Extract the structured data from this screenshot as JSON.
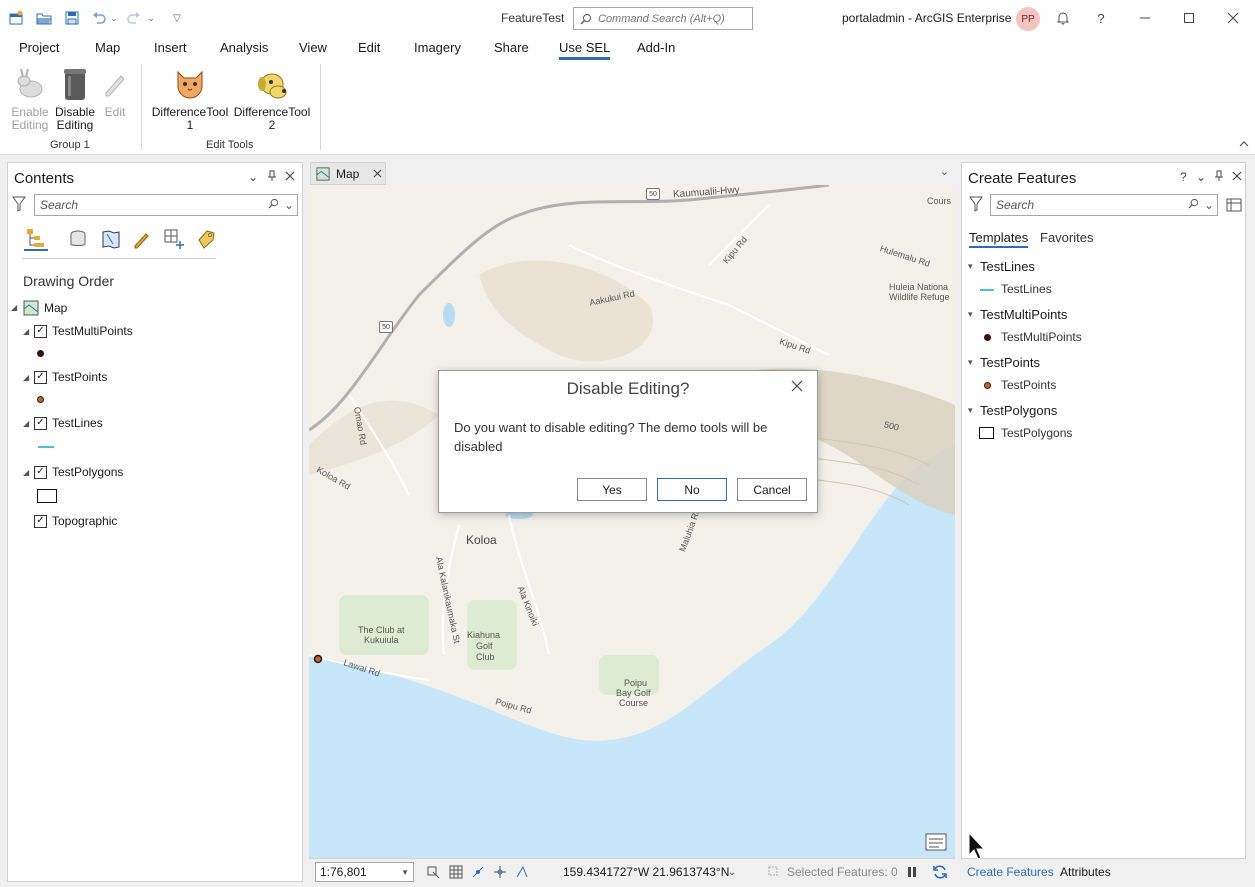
{
  "titlebar": {
    "app_title": "FeatureTest",
    "command_search_placeholder": "Command Search (Alt+Q)",
    "portal_label": "portaladmin - ArcGIS Enterprise",
    "avatar_initials": "PP",
    "help": "?"
  },
  "menu": {
    "tabs": [
      "Project",
      "Map",
      "Insert",
      "Analysis",
      "View",
      "Edit",
      "Imagery",
      "Share",
      "Use SEL",
      "Add-In"
    ],
    "active_tab": "Use SEL"
  },
  "ribbon": {
    "enable_editing": [
      "Enable",
      "Editing"
    ],
    "disable_editing": [
      "Disable",
      "Editing"
    ],
    "edit": "Edit",
    "group1_label": "Group 1",
    "difference_tool_1": [
      "DifferenceTool",
      "1"
    ],
    "difference_tool_2": [
      "DifferenceTool",
      "2"
    ],
    "edit_tools_label": "Edit Tools"
  },
  "contents": {
    "title": "Contents",
    "search_placeholder": "Search",
    "drawing_order": "Drawing Order",
    "map_label": "Map",
    "layers": {
      "multipoints": "TestMultiPoints",
      "points": "TestPoints",
      "lines": "TestLines",
      "polygons": "TestPolygons",
      "topographic": "Topographic"
    }
  },
  "map": {
    "tab_label": "Map",
    "labels": {
      "kaumualii": "Kaumualii-Hwy",
      "aakukui": "Aakukui Rd",
      "kipu1": "Kipu Rd",
      "kipu2": "Kipu Rd",
      "hulemalu": "Hulemalu Rd",
      "huleia1": "Huleia Nationa",
      "huleia2": "Wildlife Refuge",
      "omao": "Omao Rd",
      "koloa_rd": "Koloa Rd",
      "koloa": "Koloa",
      "kalanikaumaka": "Ala Kalanikaumaka St",
      "ala_kinoiki": "Ala Kinoiki",
      "maluhia": "Maluhia Rd",
      "club_kukuiula1": "The Club at",
      "club_kukuiula2": "Kukuiula",
      "kiahuna1": "Kiahuna",
      "kiahuna2": "Golf",
      "kiahuna3": "Club",
      "lawai": "Lawai Rd",
      "poipu_rd": "Poipu Rd",
      "poipu_bay1": "Poipu",
      "poipu_bay2": "Bay Golf",
      "poipu_bay3": "Course",
      "cours": "Cours",
      "shield_50a": "50",
      "shield_50b": "50",
      "contour_500": "500"
    },
    "scale": "1:76,801",
    "coordinates": "159.4341727°W 21.9613743°N",
    "selected_features": "Selected Features: 0"
  },
  "dialog": {
    "title": "Disable Editing?",
    "message": "Do you want to disable editing? The demo tools will be disabled",
    "yes": "Yes",
    "no": "No",
    "cancel": "Cancel"
  },
  "create_features": {
    "title": "Create Features",
    "help": "?",
    "search_placeholder": "Search",
    "tabs": {
      "templates": "Templates",
      "favorites": "Favorites"
    },
    "groups": {
      "lines": {
        "name": "TestLines",
        "item": "TestLines"
      },
      "multipoints": {
        "name": "TestMultiPoints",
        "item": "TestMultiPoints"
      },
      "points": {
        "name": "TestPoints",
        "item": "TestPoints"
      },
      "polygons": {
        "name": "TestPolygons",
        "item": "TestPolygons"
      }
    }
  },
  "bottom_tabs": {
    "create_features": "Create Features",
    "attributes": "Attributes"
  },
  "colors": {
    "accent": "#2e6db4",
    "ocean": "#c7e6fa",
    "land": "#f4f1ea",
    "line_symbol": "#4fc2c9"
  }
}
